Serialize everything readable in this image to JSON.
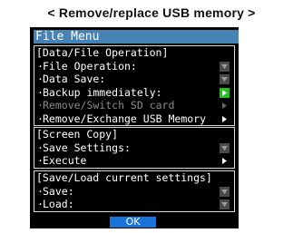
{
  "caption": "< Remove/replace USB memory >",
  "menu": {
    "title": "File Menu",
    "ok_label": "OK",
    "sections": [
      {
        "header": "[Data/File Operation]",
        "items": [
          {
            "label": "File Operation:",
            "indicator": "down-arrow-icon",
            "enabled": true
          },
          {
            "label": "Data Save:",
            "indicator": "down-arrow-icon",
            "enabled": true
          },
          {
            "label": "Backup immediately:",
            "indicator": "right-arrow-green-icon",
            "enabled": true
          },
          {
            "label": "Remove/Switch SD card",
            "indicator": "right-arrow-icon",
            "enabled": false
          },
          {
            "label": "Remove/Exchange USB Memory",
            "indicator": "right-arrow-icon",
            "enabled": true
          }
        ]
      },
      {
        "header": "[Screen Copy]",
        "items": [
          {
            "label": "Save Settings:",
            "indicator": "down-arrow-icon",
            "enabled": true
          },
          {
            "label": "Execute",
            "indicator": "right-arrow-icon",
            "enabled": true
          }
        ]
      },
      {
        "header": "[Save/Load current settings]",
        "items": [
          {
            "label": "Save:",
            "indicator": "down-arrow-icon",
            "enabled": true
          },
          {
            "label": "Load:",
            "indicator": "down-arrow-icon",
            "enabled": true
          }
        ]
      }
    ]
  },
  "colors": {
    "title_bar": "#4682b4",
    "ok_button": "#1a73d9",
    "active_indicator": "#24c21e",
    "screen_background": "#000000"
  }
}
